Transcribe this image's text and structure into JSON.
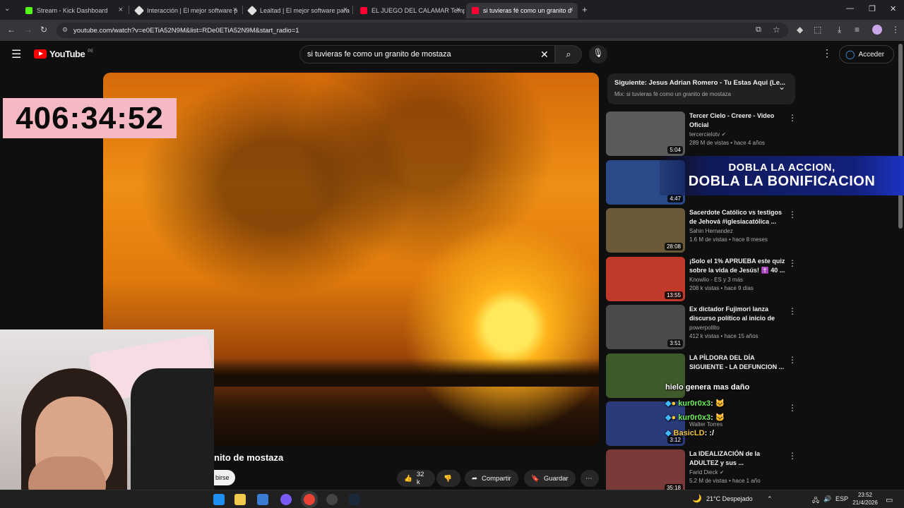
{
  "browser": {
    "tabs": [
      {
        "label": "Stream - Kick Dashboard",
        "color": "#53fc18"
      },
      {
        "label": "Interacción | El mejor software p",
        "color": "#e0e0e0"
      },
      {
        "label": "Lealtad | El mejor software para",
        "color": "#e0e0e0"
      },
      {
        "label": "EL JUEGO DEL CALAMAR Temp",
        "color": "#ff0033"
      },
      {
        "label": "si tuvieras fé como un granito d",
        "color": "#ff0033"
      }
    ],
    "url": "youtube.com/watch?v=e0ETiA52N9M&list=RDe0ETiA52N9M&start_radio=1"
  },
  "youtube": {
    "logo_text": "YouTube",
    "region": "PE",
    "search_value": "si tuvieras fe como un granito de mostaza",
    "signin_label": "Acceder"
  },
  "overlay": {
    "timer": "406:34:52",
    "banner_line1": "DOBLA LA ACCION,",
    "banner_line2": "DOBLA LA BONIFICACION",
    "chat": [
      {
        "text": "hielo genera mas daño"
      },
      {
        "user": "kur0r0x3",
        "sep": ":"
      },
      {
        "user": "kur0r0x3",
        "sep": ":"
      },
      {
        "user": "BasicLD",
        "sep": ": :/"
      }
    ]
  },
  "video": {
    "title_fragment": "nito de mostaza",
    "subscribe_fragment": "birse",
    "likes": "32 k",
    "share_label": "Compartir",
    "save_label": "Guardar"
  },
  "upnext": {
    "title": "Siguiente: Jesus Adrian Romero - Tu Estas Aqui (Le...",
    "subtitle": "Mix: si tuvieras fé como un granito de mostaza"
  },
  "recommendations": [
    {
      "title": "Tercer Cielo - Creere - Video Oficial",
      "channel": "tercercielotv",
      "meta": "289 M de vistas • hace 4 años",
      "duration": "5:04",
      "thumb": "#5a5a5a"
    },
    {
      "title": "",
      "channel": "",
      "meta": "",
      "duration": "4:47",
      "thumb": "#2a4a8a"
    },
    {
      "title": "Sacerdote Católico vs testigos de Jehová #iglesiacatólica ...",
      "channel": "Sahin Hernandez",
      "meta": "1.6 M de vistas • hace 8 meses",
      "duration": "28:08",
      "thumb": "#6b5a3a"
    },
    {
      "title": "¡Solo el 1% APRUEBA este quiz sobre la vida de Jesús! ✝️ 40 ...",
      "channel": "Knowlio - ES y 3 más",
      "meta": "208 k vistas • hace 9 días",
      "duration": "13:55",
      "thumb": "#c0392b"
    },
    {
      "title": "Ex dictador Fujimori lanza discurso político al inicio de s...",
      "channel": "powerpollito",
      "meta": "412 k vistas • hace 15 años",
      "duration": "3:51",
      "thumb": "#4a4a4a"
    },
    {
      "title": "LA PÍLDORA DEL DÍA SIGUIENTE - LA DEFUNCION ...",
      "channel": "",
      "meta": "",
      "duration": "",
      "thumb": "#3f5a2a"
    },
    {
      "title": "",
      "channel": "Walter Torres",
      "meta": "",
      "duration": "3:12",
      "thumb": "#2a3a7a"
    },
    {
      "title": "La IDEALIZACIÓN de la ADULTEZ y sus ...",
      "channel": "Farid Dieck",
      "meta": "5.2 M de vistas • hace 1 año",
      "duration": "35:18",
      "thumb": "#7a3a3a"
    }
  ],
  "taskbar": {
    "weather": "21°C  Despejado",
    "lang": "ESP",
    "time": "23:52",
    "date": "21/4/2026"
  }
}
